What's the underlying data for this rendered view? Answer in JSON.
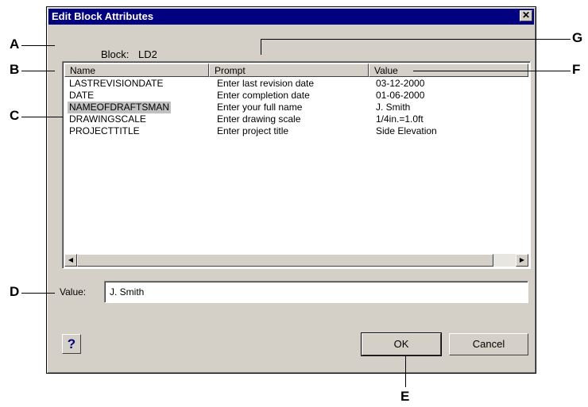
{
  "dialog": {
    "title": "Edit Block Attributes",
    "close_glyph": "✕",
    "block_label": "Block:",
    "block_value": "LD2"
  },
  "table": {
    "columns": [
      "Name",
      "Prompt",
      "Value"
    ],
    "rows": [
      {
        "name": "LASTREVISIONDATE",
        "prompt": "Enter last revision date",
        "value": "03-12-2000"
      },
      {
        "name": "DATE",
        "prompt": "Enter completion date",
        "value": "01-06-2000"
      },
      {
        "name": "NAMEOFDRAFTSMAN",
        "prompt": "Enter your full name",
        "value": "J. Smith",
        "selected": true
      },
      {
        "name": "DRAWINGSCALE",
        "prompt": "Enter drawing scale",
        "value": "1/4in.=1.0ft"
      },
      {
        "name": "PROJECTTITLE",
        "prompt": "Enter project title",
        "value": "Side Elevation"
      }
    ],
    "scroll_left_icon": "◀",
    "scroll_right_icon": "▶"
  },
  "value_field": {
    "label": "Value:",
    "value": "J. Smith"
  },
  "buttons": {
    "help": "?",
    "ok": "OK",
    "cancel": "Cancel"
  },
  "callouts": {
    "A": "A",
    "B": "B",
    "C": "C",
    "D": "D",
    "E": "E",
    "F": "F",
    "G": "G"
  }
}
